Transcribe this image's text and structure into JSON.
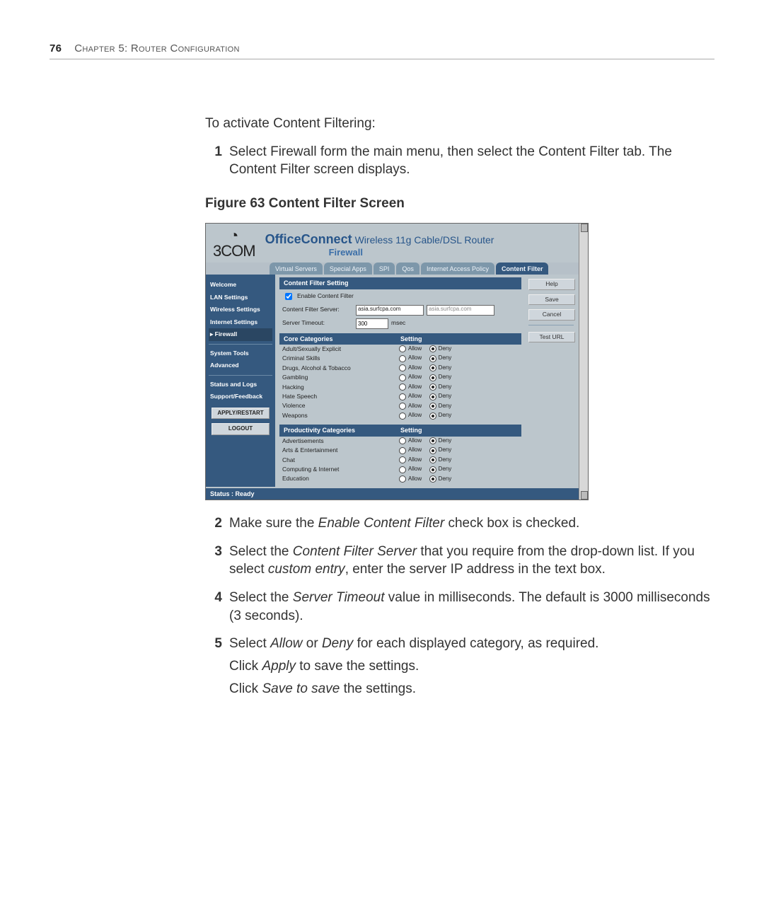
{
  "header": {
    "page_number": "76",
    "chapter": "Chapter 5: Router Configuration"
  },
  "intro": "To activate Content Filtering:",
  "figure_caption": "Figure 63  Content Filter Screen",
  "steps": {
    "s1": "Select Firewall form the main menu, then select the Content Filter tab. The Content Filter screen displays.",
    "s2_a": "Make sure the ",
    "s2_em": "Enable Content Filter",
    "s2_b": " check box is checked.",
    "s3_a": "Select the ",
    "s3_em": "Content Filter Server",
    "s3_b": " that you require from the drop-down list. If you select ",
    "s3_em2": "custom entry",
    "s3_c": ", enter the server IP address in the text box.",
    "s4_a": "Select the ",
    "s4_em": "Server Timeout",
    "s4_b": " value in milliseconds. The default is 3000 milliseconds (3 seconds).",
    "s5_a": "Select ",
    "s5_em1": "Allow",
    "s5_mid": " or ",
    "s5_em2": "Deny",
    "s5_b": " for each displayed category, as required.",
    "s5_apply_a": "Click ",
    "s5_apply_em": "Apply",
    "s5_apply_b": " to save the settings.",
    "s5_save_a": "Click ",
    "s5_save_em": "Save to save",
    "s5_save_b": " the settings."
  },
  "screenshot": {
    "brand": "OfficeConnect",
    "brand_sub": "Wireless 11g Cable/DSL Router",
    "brand_logo": "3COM",
    "breadcrumb": "Firewall",
    "tabs": [
      "Virtual Servers",
      "Special Apps",
      "SPI",
      "Qos",
      "Internet Access Policy",
      "Content Filter"
    ],
    "active_tab_index": 5,
    "sidebar": {
      "items": [
        "Welcome",
        "LAN Settings",
        "Wireless Settings",
        "Internet Settings",
        "Firewall",
        "System Tools",
        "Advanced",
        "Status and Logs",
        "Support/Feedback"
      ],
      "active_index": 4,
      "btn_apply": "APPLY/RESTART",
      "btn_logout": "LOGOUT"
    },
    "right_buttons": {
      "help": "Help",
      "save": "Save",
      "cancel": "Cancel",
      "test_url": "Test URL"
    },
    "settings": {
      "header": "Content Filter Setting",
      "enable_label": "Enable Content Filter",
      "enable_checked": true,
      "server_label": "Content Filter Server:",
      "server_select": "asia.surfcpa.com",
      "server_text": "asia.surfcpa.com",
      "timeout_label": "Server Timeout:",
      "timeout_value": "300",
      "timeout_unit": "msec"
    },
    "core": {
      "header_left": "Core Categories",
      "header_right": "Setting",
      "opt_allow": "Allow",
      "opt_deny": "Deny",
      "rows": [
        {
          "name": "Adult/Sexually Explicit",
          "sel": "deny"
        },
        {
          "name": "Criminal Skills",
          "sel": "deny"
        },
        {
          "name": "Drugs, Alcohol & Tobacco",
          "sel": "deny"
        },
        {
          "name": "Gambling",
          "sel": "deny"
        },
        {
          "name": "Hacking",
          "sel": "deny"
        },
        {
          "name": "Hate Speech",
          "sel": "deny"
        },
        {
          "name": "Violence",
          "sel": "deny"
        },
        {
          "name": "Weapons",
          "sel": "deny"
        }
      ]
    },
    "prod": {
      "header_left": "Productivity Categories",
      "header_right": "Setting",
      "rows": [
        {
          "name": "Advertisements",
          "sel": "deny"
        },
        {
          "name": "Arts & Entertainment",
          "sel": "deny"
        },
        {
          "name": "Chat",
          "sel": "deny"
        },
        {
          "name": "Computing & Internet",
          "sel": "deny"
        },
        {
          "name": "Education",
          "sel": "deny"
        }
      ]
    },
    "status": "Status : Ready"
  }
}
